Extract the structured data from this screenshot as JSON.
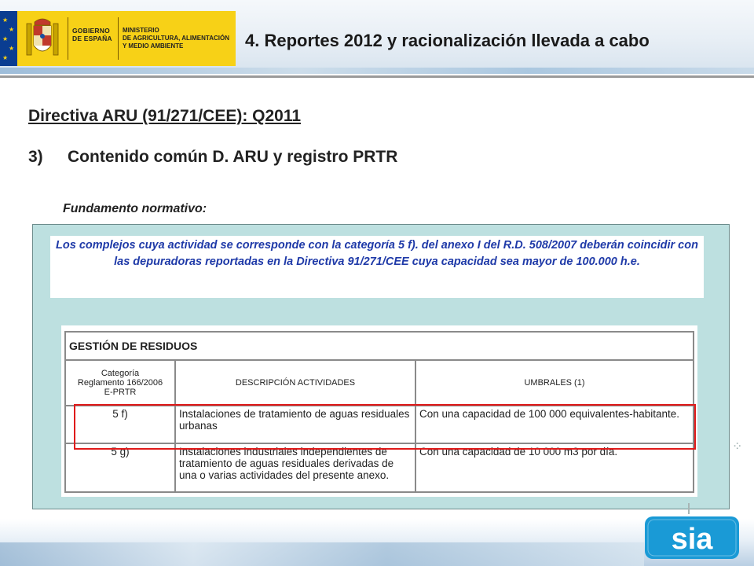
{
  "header": {
    "gov_text": "GOBIERNO\nDE ESPAÑA",
    "ministry_text": "MINISTERIO\nDE AGRICULTURA, ALIMENTACIÓN\nY MEDIO AMBIENTE",
    "title": "4. Reportes 2012 y racionalización llevada a cabo"
  },
  "content": {
    "heading1": "Directiva ARU (91/271/CEE): Q2011",
    "heading2_number": "3)",
    "heading2_text": "Contenido común D. ARU y registro PRTR",
    "subheading": "Fundamento normativo:",
    "callout": "Los complejos cuya actividad se corresponde con la categoría 5 f). del anexo I del R.D. 508/2007 deberán coincidir con las depuradoras reportadas en la Directiva 91/271/CEE cuya capacidad sea mayor de 100.000 h.e."
  },
  "table": {
    "title": "GESTIÓN DE RESIDUOS",
    "col_category": "Categoría\nReglamento 166/2006\nE-PRTR",
    "col_description": "DESCRIPCIÓN ACTIVIDADES",
    "col_threshold": "UMBRALES (1)",
    "rows": [
      {
        "category": "5 f)",
        "description": "Instalaciones de tratamiento de aguas residuales urbanas",
        "threshold": "Con una capacidad de 100 000 equivalentes-habitante."
      },
      {
        "category": "5 g)",
        "description": "Instalaciones industriales independientes de tratamiento de aguas residuales derivadas de una o varias actividades del presente anexo.",
        "threshold": "Con una capacidad de 10 000 m3 por día."
      }
    ]
  },
  "footer": {
    "logo_text": "sia"
  },
  "colors": {
    "accent_yellow": "#f7d117",
    "eu_blue": "#0a3d91",
    "panel_teal": "#bde0e0",
    "callout_blue": "#1f3aa8",
    "highlight_red": "#e01a1a",
    "sia_blue": "#1a9ad6"
  }
}
